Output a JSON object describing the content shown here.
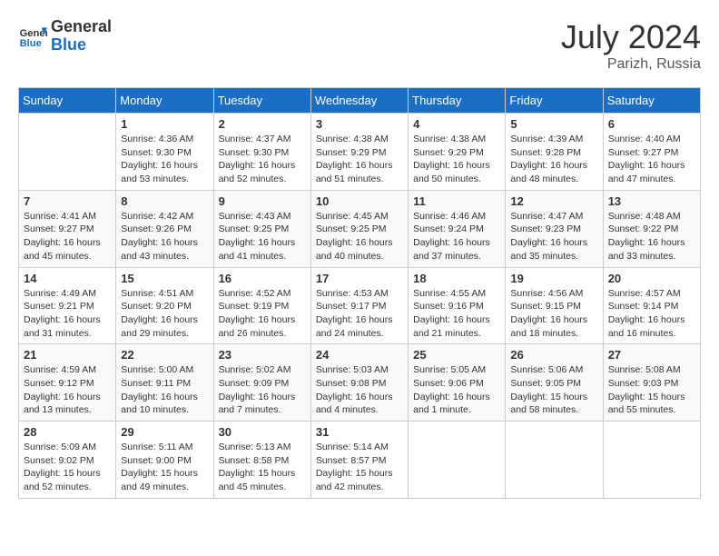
{
  "header": {
    "logo_line1": "General",
    "logo_line2": "Blue",
    "month_year": "July 2024",
    "location": "Parizh, Russia"
  },
  "days_of_week": [
    "Sunday",
    "Monday",
    "Tuesday",
    "Wednesday",
    "Thursday",
    "Friday",
    "Saturday"
  ],
  "weeks": [
    [
      {
        "day": "",
        "info": ""
      },
      {
        "day": "1",
        "info": "Sunrise: 4:36 AM\nSunset: 9:30 PM\nDaylight: 16 hours\nand 53 minutes."
      },
      {
        "day": "2",
        "info": "Sunrise: 4:37 AM\nSunset: 9:30 PM\nDaylight: 16 hours\nand 52 minutes."
      },
      {
        "day": "3",
        "info": "Sunrise: 4:38 AM\nSunset: 9:29 PM\nDaylight: 16 hours\nand 51 minutes."
      },
      {
        "day": "4",
        "info": "Sunrise: 4:38 AM\nSunset: 9:29 PM\nDaylight: 16 hours\nand 50 minutes."
      },
      {
        "day": "5",
        "info": "Sunrise: 4:39 AM\nSunset: 9:28 PM\nDaylight: 16 hours\nand 48 minutes."
      },
      {
        "day": "6",
        "info": "Sunrise: 4:40 AM\nSunset: 9:27 PM\nDaylight: 16 hours\nand 47 minutes."
      }
    ],
    [
      {
        "day": "7",
        "info": "Sunrise: 4:41 AM\nSunset: 9:27 PM\nDaylight: 16 hours\nand 45 minutes."
      },
      {
        "day": "8",
        "info": "Sunrise: 4:42 AM\nSunset: 9:26 PM\nDaylight: 16 hours\nand 43 minutes."
      },
      {
        "day": "9",
        "info": "Sunrise: 4:43 AM\nSunset: 9:25 PM\nDaylight: 16 hours\nand 41 minutes."
      },
      {
        "day": "10",
        "info": "Sunrise: 4:45 AM\nSunset: 9:25 PM\nDaylight: 16 hours\nand 40 minutes."
      },
      {
        "day": "11",
        "info": "Sunrise: 4:46 AM\nSunset: 9:24 PM\nDaylight: 16 hours\nand 37 minutes."
      },
      {
        "day": "12",
        "info": "Sunrise: 4:47 AM\nSunset: 9:23 PM\nDaylight: 16 hours\nand 35 minutes."
      },
      {
        "day": "13",
        "info": "Sunrise: 4:48 AM\nSunset: 9:22 PM\nDaylight: 16 hours\nand 33 minutes."
      }
    ],
    [
      {
        "day": "14",
        "info": "Sunrise: 4:49 AM\nSunset: 9:21 PM\nDaylight: 16 hours\nand 31 minutes."
      },
      {
        "day": "15",
        "info": "Sunrise: 4:51 AM\nSunset: 9:20 PM\nDaylight: 16 hours\nand 29 minutes."
      },
      {
        "day": "16",
        "info": "Sunrise: 4:52 AM\nSunset: 9:19 PM\nDaylight: 16 hours\nand 26 minutes."
      },
      {
        "day": "17",
        "info": "Sunrise: 4:53 AM\nSunset: 9:17 PM\nDaylight: 16 hours\nand 24 minutes."
      },
      {
        "day": "18",
        "info": "Sunrise: 4:55 AM\nSunset: 9:16 PM\nDaylight: 16 hours\nand 21 minutes."
      },
      {
        "day": "19",
        "info": "Sunrise: 4:56 AM\nSunset: 9:15 PM\nDaylight: 16 hours\nand 18 minutes."
      },
      {
        "day": "20",
        "info": "Sunrise: 4:57 AM\nSunset: 9:14 PM\nDaylight: 16 hours\nand 16 minutes."
      }
    ],
    [
      {
        "day": "21",
        "info": "Sunrise: 4:59 AM\nSunset: 9:12 PM\nDaylight: 16 hours\nand 13 minutes."
      },
      {
        "day": "22",
        "info": "Sunrise: 5:00 AM\nSunset: 9:11 PM\nDaylight: 16 hours\nand 10 minutes."
      },
      {
        "day": "23",
        "info": "Sunrise: 5:02 AM\nSunset: 9:09 PM\nDaylight: 16 hours\nand 7 minutes."
      },
      {
        "day": "24",
        "info": "Sunrise: 5:03 AM\nSunset: 9:08 PM\nDaylight: 16 hours\nand 4 minutes."
      },
      {
        "day": "25",
        "info": "Sunrise: 5:05 AM\nSunset: 9:06 PM\nDaylight: 16 hours\nand 1 minute."
      },
      {
        "day": "26",
        "info": "Sunrise: 5:06 AM\nSunset: 9:05 PM\nDaylight: 15 hours\nand 58 minutes."
      },
      {
        "day": "27",
        "info": "Sunrise: 5:08 AM\nSunset: 9:03 PM\nDaylight: 15 hours\nand 55 minutes."
      }
    ],
    [
      {
        "day": "28",
        "info": "Sunrise: 5:09 AM\nSunset: 9:02 PM\nDaylight: 15 hours\nand 52 minutes."
      },
      {
        "day": "29",
        "info": "Sunrise: 5:11 AM\nSunset: 9:00 PM\nDaylight: 15 hours\nand 49 minutes."
      },
      {
        "day": "30",
        "info": "Sunrise: 5:13 AM\nSunset: 8:58 PM\nDaylight: 15 hours\nand 45 minutes."
      },
      {
        "day": "31",
        "info": "Sunrise: 5:14 AM\nSunset: 8:57 PM\nDaylight: 15 hours\nand 42 minutes."
      },
      {
        "day": "",
        "info": ""
      },
      {
        "day": "",
        "info": ""
      },
      {
        "day": "",
        "info": ""
      }
    ]
  ]
}
